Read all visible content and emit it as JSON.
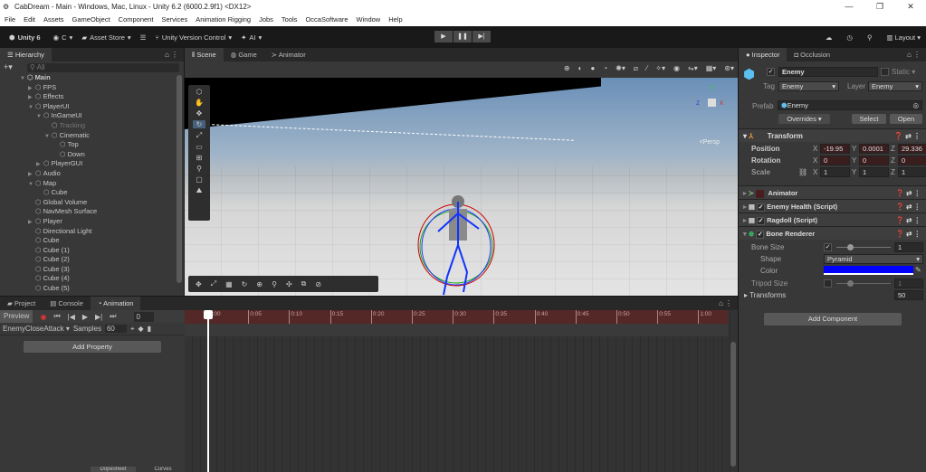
{
  "window": {
    "title": "CabDream - Main - Windows, Mac, Linux - Unity 6.2 (6000.2.9f1) <DX12>",
    "controls": [
      "—",
      "❐",
      "✕"
    ]
  },
  "menu": [
    "File",
    "Edit",
    "Assets",
    "GameObject",
    "Component",
    "Services",
    "Animation Rigging",
    "Jobs",
    "Tools",
    "OccaSoftware",
    "Window",
    "Help"
  ],
  "toolbar": {
    "unity": "Unity 6",
    "account": "C",
    "asset_store": "Asset Store",
    "version_control": "Unity Version Control",
    "ai": "AI",
    "layout": "Layout"
  },
  "hierarchy": {
    "tab": "Hierarchy",
    "search_placeholder": "All",
    "items": [
      {
        "label": "Main",
        "depth": 0,
        "arrow": "▼",
        "bold": true
      },
      {
        "label": "FPS",
        "depth": 1,
        "arrow": "▶"
      },
      {
        "label": "Effects",
        "depth": 1,
        "arrow": "▶"
      },
      {
        "label": "PlayerUI",
        "depth": 1,
        "arrow": "▼"
      },
      {
        "label": "InGameUI",
        "depth": 2,
        "arrow": "▼"
      },
      {
        "label": "Tracking",
        "depth": 3,
        "arrow": "",
        "disabled": true
      },
      {
        "label": "Cinematic",
        "depth": 3,
        "arrow": "▼"
      },
      {
        "label": "Top",
        "depth": 4,
        "arrow": ""
      },
      {
        "label": "Down",
        "depth": 4,
        "arrow": ""
      },
      {
        "label": "PlayerGUI",
        "depth": 2,
        "arrow": "▶"
      },
      {
        "label": "Audio",
        "depth": 1,
        "arrow": "▶"
      },
      {
        "label": "Map",
        "depth": 1,
        "arrow": "▼"
      },
      {
        "label": "Cube",
        "depth": 2,
        "arrow": ""
      },
      {
        "label": "Global Volume",
        "depth": 1,
        "arrow": ""
      },
      {
        "label": "NavMesh Surface",
        "depth": 1,
        "arrow": ""
      },
      {
        "label": "Player",
        "depth": 1,
        "arrow": "▶"
      },
      {
        "label": "Directional Light",
        "depth": 1,
        "arrow": ""
      },
      {
        "label": "Cube",
        "depth": 1,
        "arrow": ""
      },
      {
        "label": "Cube (1)",
        "depth": 1,
        "arrow": ""
      },
      {
        "label": "Cube (2)",
        "depth": 1,
        "arrow": ""
      },
      {
        "label": "Cube (3)",
        "depth": 1,
        "arrow": ""
      },
      {
        "label": "Cube (4)",
        "depth": 1,
        "arrow": ""
      },
      {
        "label": "Cube (5)",
        "depth": 1,
        "arrow": ""
      }
    ]
  },
  "scene": {
    "tabs": [
      "Scene",
      "Game",
      "Animator"
    ],
    "persp": "<Persp"
  },
  "bottom": {
    "tabs": [
      "Project",
      "Console",
      "Animation"
    ],
    "preview": "Preview",
    "frame": "0",
    "clip": "EnemyCloseAttack",
    "samples_label": "Samples",
    "samples": "60",
    "add_property": "Add Property",
    "dopesheet": "Dopesheet",
    "curves": "Curves",
    "ticks": [
      "0:00",
      "0:05",
      "0:10",
      "0:15",
      "0:20",
      "0:25",
      "0:30",
      "0:35",
      "0:40",
      "0:45",
      "0:50",
      "0:55",
      "1:00"
    ]
  },
  "inspector": {
    "tabs": [
      "Inspector",
      "Occlusion"
    ],
    "name": "Enemy",
    "static": "Static",
    "tag_label": "Tag",
    "tag": "Enemy",
    "layer_label": "Layer",
    "layer": "Enemy",
    "prefab_label": "Prefab",
    "prefab": "Enemy",
    "overrides": "Overrides",
    "select": "Select",
    "open": "Open",
    "transform": {
      "title": "Transform",
      "position": "Position",
      "rotation": "Rotation",
      "scale": "Scale",
      "pos": [
        "-19.95",
        "0.0001",
        "29.336"
      ],
      "rot": [
        "0",
        "0",
        "0"
      ],
      "scl": [
        "1",
        "1",
        "1"
      ]
    },
    "components": [
      "Animator",
      "Enemy Health (Script)",
      "Ragdoll (Script)",
      "Bone Renderer"
    ],
    "bone": {
      "size_label": "Bone Size",
      "size": "1",
      "shape_label": "Shape",
      "shape": "Pyramid",
      "color_label": "Color",
      "color": "#0000ff",
      "tripod_label": "Tripod Size",
      "tripod": "1",
      "transforms_label": "Transforms",
      "transforms": "50"
    },
    "add_component": "Add Component"
  }
}
